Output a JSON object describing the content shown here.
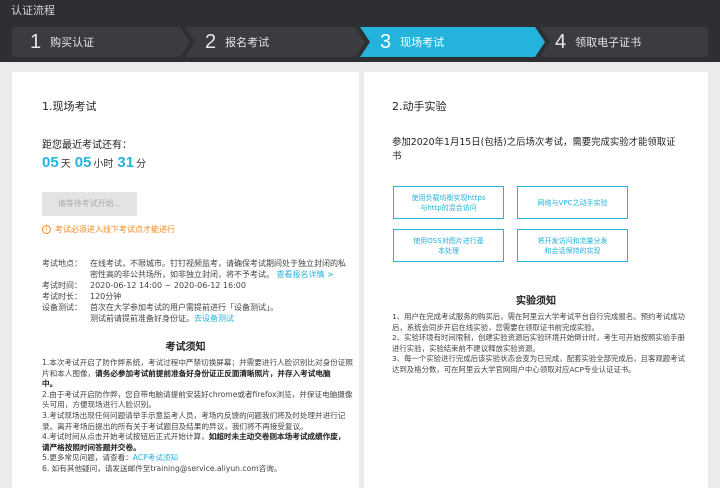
{
  "app": {
    "title": "认证流程"
  },
  "steps": [
    {
      "num": "1",
      "label": "购买认证"
    },
    {
      "num": "2",
      "label": "报名考试"
    },
    {
      "num": "3",
      "label": "现场考试"
    },
    {
      "num": "4",
      "label": "领取电子证书"
    }
  ],
  "colors": {
    "accent": "#24b3dd",
    "warning": "#f08a24",
    "dark": "#2d2f33"
  },
  "left": {
    "title": "1.现场考试",
    "countdown_label": "距您最近考试还有：",
    "days": "05",
    "days_unit": "天",
    "hours": "05",
    "hours_unit": "小时",
    "minutes": "31",
    "minutes_unit": "分",
    "wait_button": "请等待考试开始...",
    "warning": "考试必须进入线下考试点才能进行",
    "info": {
      "location_label": "考试地点：",
      "location_1": "在线考试，不限城市。钉钉视频监考，请确保考试期间处于独立封闭的私",
      "location_2": "密性高的非公共场所，如非独立封闭，将不予考试。",
      "location_link": "查看报名详情 >",
      "time_label": "考试时间：",
      "time_value": "2020-06-12 14:00 ~ 2020-06-12 16:00",
      "duration_label": "考试时长：",
      "duration_value": "120分钟",
      "device_label": "设备测试：",
      "device_value_1": "首次在大学参加考试的用户需提前进行「设备测试」。",
      "device_value_2": "测试前请提前准备好身份证。",
      "device_link": "去设备测试"
    },
    "notice_title": "考试须知",
    "notice": {
      "n1a": "1.本次考试开启了防作弊系统，考试过程中严禁切换屏幕；并需要进行人脸识别比对身份证照",
      "n1b": "片和本人图像，",
      "n1b_bold": "请务必参加考试前提前准备好身份证正反面清晰照片，并存入考试电脑",
      "n1c_bold": "中。",
      "n2a": "2.由于考试开启防作弊，您自带电脑请提前安装好chrome或者firefox浏览，并保证电脑摄像",
      "n2b": "头可用，方便现场进行人脸识别。",
      "n3a": "3.考试现场出现任何问题请举手示意监考人员，考场内反馈的问题我们将及时处理并进行记",
      "n3b": "录。离开考场后提出的所有关于考试题目及结果的异议，我们将不再接受复议。",
      "n4a": "4.考试时间从点击开始考试按钮后正式开始计算，",
      "n4a_bold": "如超时未主动交卷则本场考试成绩作废，",
      "n4b_bold": "请严格按照时间答题并交卷。",
      "n5": "5.更多常见问题，请查看：",
      "n5_link": "ACP考试须知",
      "n6": "6. 如有其他疑问，请发送邮件至training@service.aliyun.com咨询。"
    }
  },
  "right": {
    "title": "2.动手实验",
    "desc_1": "参加2020年1月15日(包括)之后场次考试，需要完成实验才能领取证",
    "desc_2": "书",
    "labs": [
      {
        "l1": "使用负载均衡实现https",
        "l2": "与http的混合访问"
      },
      {
        "l1": "网络与VPC之动手实验",
        "l2": ""
      },
      {
        "l1": "使用OSS对图片进行基",
        "l2": "本处理"
      },
      {
        "l1": "将开发访问和流量分发",
        "l2": "和会话保持的实现"
      }
    ],
    "notice_title": "实验须知",
    "notice": {
      "n1a": "1、用户在完成考试服务的购买后，需在阿里云大学考试平台自行完成报名。预约考试成功",
      "n1b": "后，系统会同步开启在线实验，您需要在领取证书前完成实验。",
      "n2a": "2、实验环境有时间限制，创建实验资源后实验环境开始倒计时，考生可开始按照实验手册",
      "n2b": "进行实验，实验结束前不建议释放实验资源。",
      "n3a": "3、每一个实验进行完成后该实验状态会变为已完成，配套实验全部完成后，且客观题考试",
      "n3b": "达到及格分数，可在阿里云大学官网用户中心领取对应ACP专业认证证书。"
    }
  }
}
